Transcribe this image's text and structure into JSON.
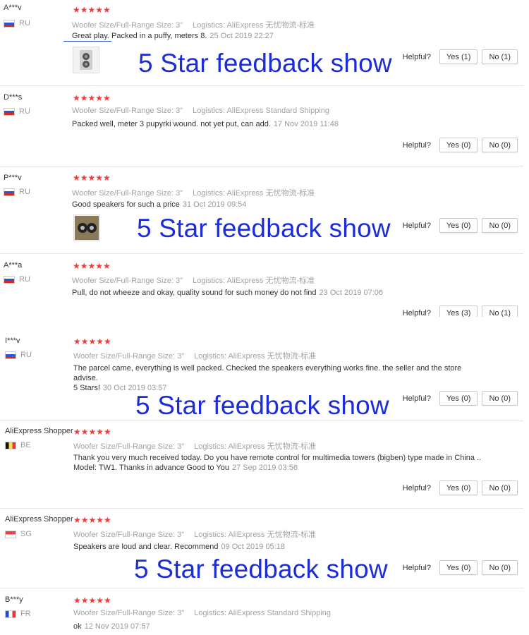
{
  "helpful_label": "Helpful?",
  "rating_stars": "★★★★★",
  "watermark_text": "5 Star feedback show",
  "colors": {
    "stars": "#f13a3a",
    "watermark": "#1c2cd6"
  },
  "reviews": [
    {
      "user": "A***v",
      "country": "RU",
      "flag": "flag-ru-icon",
      "rating": 5,
      "size": "Woofer Size/Full-Range Size: 3\"",
      "logistics": "Logistics: AliExpress 无忧物流-标准",
      "text": "Great play. Packed in a puffy, meters 8.",
      "date": "25 Oct 2019 22:27",
      "yes": "Yes (1)",
      "no": "No (1)"
    },
    {
      "user": "D***s",
      "country": "RU",
      "flag": "flag-ru-icon",
      "rating": 5,
      "size": "Woofer Size/Full-Range Size: 3\"",
      "logistics": "Logistics: AliExpress Standard Shipping",
      "text": "Packed well, meter 3 pupyrki wound. not yet put, can add.",
      "date": "17 Nov 2019 11:48",
      "yes": "Yes (0)",
      "no": "No (0)"
    },
    {
      "user": "P***v",
      "country": "RU",
      "flag": "flag-ru-icon",
      "rating": 5,
      "size": "Woofer Size/Full-Range Size: 3\"",
      "logistics": "Logistics: AliExpress 无忧物流-标准",
      "text": "Good speakers for such a price",
      "date": "31 Oct 2019 09:54",
      "yes": "Yes (0)",
      "no": "No (0)"
    },
    {
      "user": "A***a",
      "country": "RU",
      "flag": "flag-ru-icon",
      "rating": 5,
      "size": "Woofer Size/Full-Range Size: 3\"",
      "logistics": "Logistics: AliExpress 无忧物流-标准",
      "text": "Pull, do not wheeze and okay, quality sound for such money do not find",
      "date": "23 Oct 2019 07:06",
      "yes": "Yes (3)",
      "no": "No (1)"
    },
    {
      "user": "I***v",
      "country": "RU",
      "flag": "flag-ru-icon",
      "rating": 5,
      "size": "Woofer Size/Full-Range Size: 3\"",
      "logistics": "Logistics: AliExpress 无忧物流-标准",
      "text_line1": "The parcel came, everything is well packed. Checked the speakers everything works fine. the seller and the store advise.",
      "text_line2": "5 Stars!",
      "date": "30 Oct 2019 03:57",
      "yes": "Yes (0)",
      "no": "No (0)"
    },
    {
      "user": "AliExpress Shopper",
      "country": "BE",
      "flag": "flag-be-icon",
      "rating": 5,
      "size": "Woofer Size/Full-Range Size: 3\"",
      "logistics": "Logistics: AliExpress 无忧物流-标准",
      "text_line1": "Thank you very much received today. Do you have remote control for multimedia towers (bigben) type made in China ..",
      "text_line2": "Model: TW1. Thanks in advance Good to You",
      "date": "27 Sep 2019 03:56",
      "yes": "Yes (0)",
      "no": "No (0)"
    },
    {
      "user": "AliExpress Shopper",
      "country": "SG",
      "flag": "flag-sg-icon",
      "rating": 5,
      "size": "Woofer Size/Full-Range Size: 3\"",
      "logistics": "Logistics: AliExpress 无忧物流-标准",
      "text": "Speakers are loud and clear. Recommend",
      "date": "09 Oct 2019 05:18",
      "yes": "Yes (0)",
      "no": "No (0)"
    },
    {
      "user": "B***y",
      "country": "FR",
      "flag": "flag-fr-icon",
      "rating": 5,
      "size": "Woofer Size/Full-Range Size: 3\"",
      "logistics": "Logistics: AliExpress Standard Shipping",
      "text": "ok",
      "date": "12 Nov 2019 07:57"
    }
  ]
}
